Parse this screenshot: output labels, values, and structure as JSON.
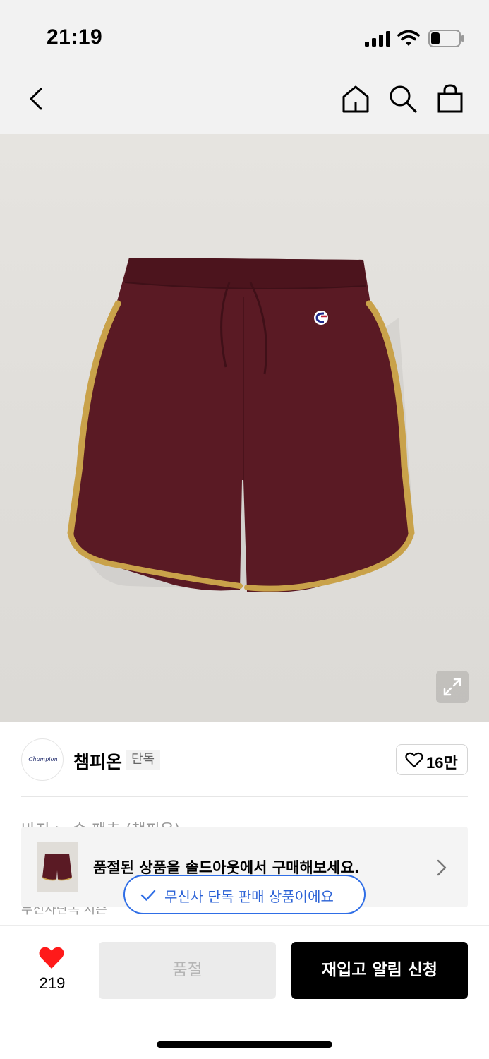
{
  "status_bar": {
    "time": "21:19"
  },
  "header": {
    "icons": [
      "chevron-left-icon",
      "home-icon",
      "search-icon",
      "shopping-bag-icon"
    ]
  },
  "product_image": {
    "icons": [
      "expand-icon"
    ]
  },
  "brand": {
    "name": "챔피온",
    "tag": "단독",
    "logo_text": "Champion",
    "likes": "16만"
  },
  "partial": {
    "category_line": "바지 > 숏 팬츠 (챔피온)",
    "tag_line": "무신사단독 시즌"
  },
  "soldout_banner": {
    "text": "품절된 상품을 솔드아웃에서 구매해보세요."
  },
  "toast": {
    "text": "무신사 단독 판매 상품이에요"
  },
  "bottom_bar": {
    "wish_count": "219",
    "soldout_label": "품절",
    "restock_label": "재입고 알림 신청"
  },
  "colors": {
    "accent_blue": "#2f6ee6",
    "heart_red": "#ff1a1a",
    "shorts_maroon": "#5a1a24",
    "trim_gold": "#c9a24a"
  }
}
